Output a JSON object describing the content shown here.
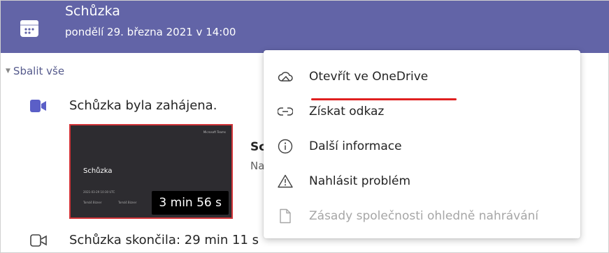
{
  "header": {
    "title": "Schůzka",
    "subtitle": "pondělí 29. března 2021 v 14:00"
  },
  "collapse_all": "Sbalit vše",
  "events": [
    {
      "text": "Schůzka byla zahájena.",
      "icon": "video-camera-icon"
    },
    {
      "text": "Schůzka skončila: 29 min 11 s",
      "icon": "video-camera-off-icon"
    }
  ],
  "recording": {
    "brand": "Microsoft Teams",
    "title": "Schůzka",
    "date": "2021-03-29 10:30 UTC",
    "participant_1": "Tomáš Bizner",
    "participant_2": "Tomáš Bizner",
    "duration": "3 min 56 s"
  },
  "peek": {
    "title": "Sc",
    "subtitle": "Na"
  },
  "menu": {
    "items": [
      {
        "label": "Otevřít ve OneDrive",
        "icon": "cloud-icon",
        "enabled": true,
        "highlighted": true
      },
      {
        "label": "Získat odkaz",
        "icon": "link-icon",
        "enabled": true
      },
      {
        "label": "Další informace",
        "icon": "info-icon",
        "enabled": true
      },
      {
        "label": "Nahlásit problém",
        "icon": "warning-icon",
        "enabled": true
      },
      {
        "label": "Zásady společnosti ohledně nahrávání",
        "icon": "document-icon",
        "enabled": false
      }
    ]
  },
  "colors": {
    "header_bg": "#6264a7",
    "highlight_underline": "#e02020",
    "thumbnail_border": "#d13438"
  }
}
